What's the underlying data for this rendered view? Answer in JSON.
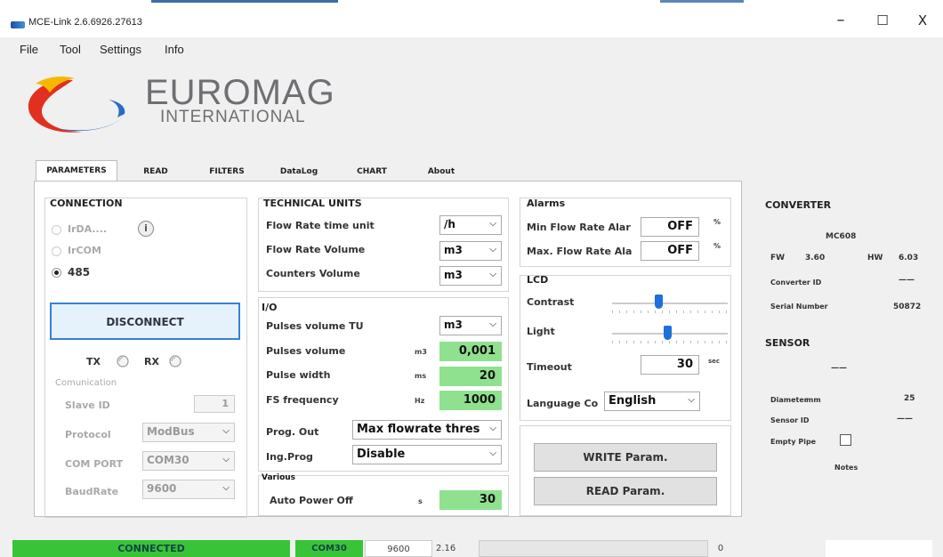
{
  "window": {
    "title": "MCE-Link 2.6.6926.27613",
    "minimize": "–",
    "maximize": "☐",
    "close": "X"
  },
  "menu": [
    "File",
    "Tool",
    "Settings",
    "Info"
  ],
  "logo": {
    "line1": "EUROMAG",
    "line2": "INTERNATIONAL"
  },
  "tabs": [
    "PARAMETERS",
    "READ",
    "FILTERS",
    "DataLog",
    "CHART",
    "About"
  ],
  "connection": {
    "title": "CONNECTION",
    "options": [
      "IrDA....",
      "IrCOM",
      "485"
    ],
    "selected": "485",
    "info_icon": "i",
    "disconnect_label": "DISCONNECT",
    "tx": "TX",
    "rx": "RX",
    "communication": "Comunication",
    "slave_id_label": "Slave ID",
    "slave_id_value": "1",
    "protocol_label": "Protocol",
    "protocol_value": "ModBus",
    "com_port_label": "COM PORT",
    "com_port_value": "COM30",
    "baudrate_label": "BaudRate",
    "baudrate_value": "9600"
  },
  "technical_units": {
    "title": "TECHNICAL UNITS",
    "flow_rate_time_label": "Flow Rate time unit",
    "flow_rate_time_value": "/h",
    "flow_rate_volume_label": "Flow Rate Volume",
    "flow_rate_volume_value": "m3",
    "counters_volume_label": "Counters Volume",
    "counters_volume_value": "m3"
  },
  "io": {
    "title": "I/O",
    "pulses_volume_tu_label": "Pulses volume TU",
    "pulses_volume_tu_value": "m3",
    "pulses_volume_label": "Pulses volume",
    "pulses_volume_unit": "m3",
    "pulses_volume_value": "0,001",
    "pulse_width_label": "Pulse width",
    "pulse_width_unit": "ms",
    "pulse_width_value": "20",
    "fs_frequency_label": "FS frequency",
    "fs_frequency_unit": "Hz",
    "fs_frequency_value": "1000",
    "prog_out_label": "Prog. Out",
    "prog_out_value": "Max flowrate thres",
    "ing_prog_label": "Ing.Prog",
    "ing_prog_value": "Disable"
  },
  "various": {
    "title": "Various",
    "auto_power_off_label": "Auto Power Off",
    "auto_power_off_unit": "s",
    "auto_power_off_value": "30"
  },
  "alarms": {
    "title": "Alarms",
    "min_label": "Min Flow Rate Alar",
    "min_value": "OFF",
    "min_unit": "%",
    "max_label": "Max. Flow Rate Ala",
    "max_value": "OFF",
    "max_unit": "%"
  },
  "lcd": {
    "title": "LCD",
    "contrast_label": "Contrast",
    "contrast_level": 0.4,
    "light_label": "Light",
    "light_level": 0.48,
    "timeout_label": "Timeout",
    "timeout_value": "30",
    "timeout_unit": "sec",
    "language_label": "Language Co",
    "language_value": "English"
  },
  "buttons": {
    "write": "WRITE Param.",
    "read": "READ Param."
  },
  "converter": {
    "title": "CONVERTER",
    "model": "MC608",
    "fw_label": "FW",
    "fw_value": "3.60",
    "hw_label": "HW",
    "hw_value": "6.03",
    "id_label": "Converter ID",
    "id_value": "——",
    "serial_label": "Serial Number",
    "serial_value": "50872"
  },
  "sensor": {
    "title": "SENSOR",
    "dash": "——",
    "diameter_label": "Diameter",
    "diameter_unit": "mm",
    "diameter_value": "25",
    "id_label": "Sensor ID",
    "id_value": "——",
    "empty_pipe_label": "Empty Pipe",
    "notes_label": "Notes"
  },
  "status": {
    "connected": "CONNECTED",
    "port": "COM30",
    "baud": "9600",
    "version": "2.16",
    "count": "0"
  },
  "colors": {
    "connected_green": "#39c339",
    "value_green": "#8fe18f",
    "accent_blue": "#1e6fd9"
  }
}
